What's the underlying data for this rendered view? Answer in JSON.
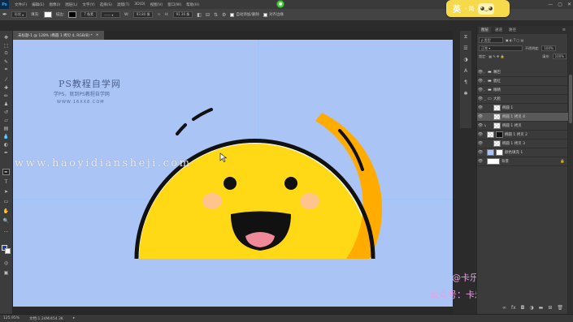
{
  "menubar": {
    "logo": "Ps",
    "items": [
      "文件(F)",
      "编辑(E)",
      "图像(I)",
      "图层(L)",
      "文字(Y)",
      "选择(S)",
      "滤镜(T)",
      "3D(D)",
      "视图(V)",
      "窗口(W)",
      "帮助(H)"
    ],
    "window_controls": [
      "—",
      "▢",
      "✕"
    ]
  },
  "options": {
    "shape_mode": "形状",
    "fill_label": "填充:",
    "stroke_label": "描边:",
    "stroke_width": "7 像素",
    "w_label": "W:",
    "w_value": "93.84 像",
    "h_label": "H:",
    "h_value": "91.36 像",
    "auto_add_label": "自动添加/删除",
    "align_edges_label": "对齐边缘"
  },
  "ime": {
    "lang": "英",
    "dots": "· 简"
  },
  "document": {
    "tab_title": "未标题-1 @ 128% (椭圆 1 拷贝 4, RGB/8) *"
  },
  "watermark": {
    "title": "PS教程自学网",
    "subtitle": "学PS，就到PS教程自学网",
    "url_small": "WWW.16XX8.COM",
    "url_large": "www.haoyidiansheji.com"
  },
  "credits": {
    "line1": "@卡乐筠",
    "line2": "公众号：卡乐筠"
  },
  "statusbar": {
    "zoom": "125.95%",
    "doc": "文档:1.24M/454.3K"
  },
  "layers_panel": {
    "tabs": [
      "图层",
      "通道",
      "路径"
    ],
    "kind_label": "ρ 类型",
    "blend_mode": "正常",
    "opacity_label": "不透明度:",
    "opacity_value": "100%",
    "lock_label": "锁定:",
    "fill_label": "填充:",
    "fill_value": "100%",
    "layers": [
      {
        "name": "嘴巴",
        "type": "group",
        "selected": false
      },
      {
        "name": "腮红",
        "type": "group",
        "selected": false
      },
      {
        "name": "眼睛",
        "type": "group",
        "selected": false
      },
      {
        "name": "大脸",
        "type": "group-open",
        "selected": false
      },
      {
        "name": "椭圆 1",
        "type": "shape",
        "selected": false
      },
      {
        "name": "椭圆 1 拷贝 4",
        "type": "shape",
        "selected": true
      },
      {
        "name": "椭圆 1 拷贝",
        "type": "shape",
        "selected": false
      },
      {
        "name": "椭圆 1 拷贝 2",
        "type": "shape-mask",
        "selected": false
      },
      {
        "name": "椭圆 1 拷贝 3",
        "type": "shape",
        "selected": false
      },
      {
        "name": "颜色填充 1",
        "type": "fill",
        "selected": false
      },
      {
        "name": "背景",
        "type": "background",
        "selected": false
      }
    ]
  },
  "colors": {
    "canvas_bg": "#aac5f5",
    "face": "#ffd915",
    "face_shadow": "#ffab00",
    "outline": "#111111",
    "cheek": "#ffc0a0",
    "tongue": "#f08a9a"
  }
}
